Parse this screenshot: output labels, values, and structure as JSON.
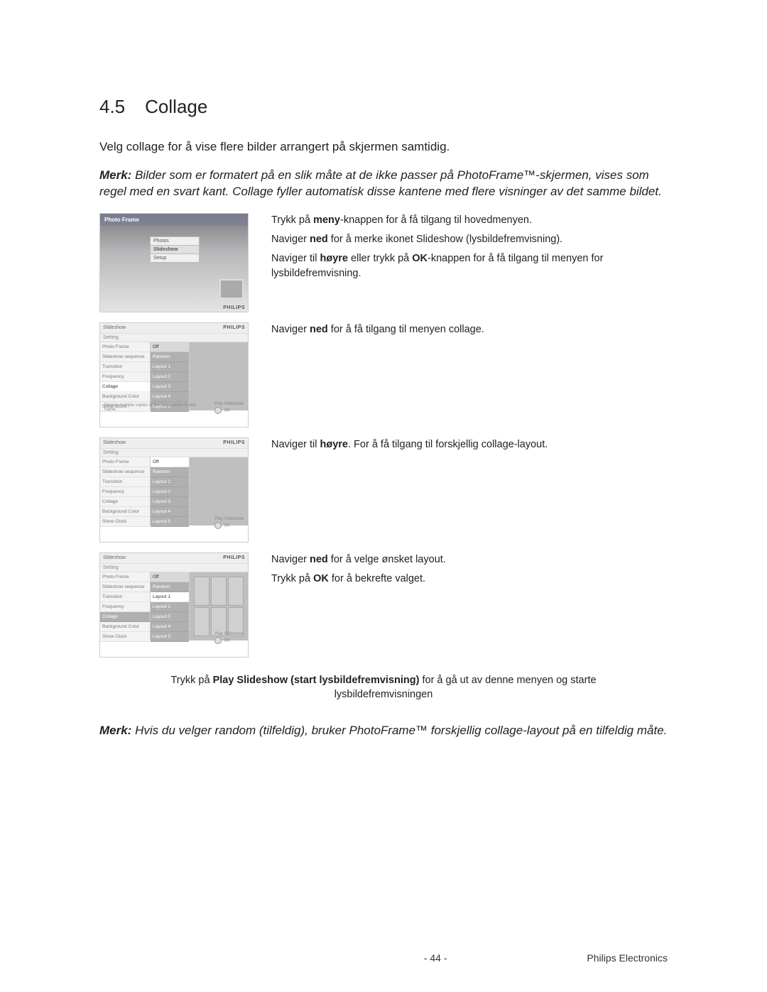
{
  "section": {
    "number": "4.5",
    "title": "Collage"
  },
  "intro": "Velg collage for å vise flere bilder arrangert på skjermen samtidig.",
  "note1": {
    "label": "Merk:",
    "text": "Bilder som er formatert på en slik måte at de ikke passer på PhotoFrame™-skjermen, vises som regel med en svart kant. Collage fyller automatisk disse kantene med flere visninger av det samme bildet."
  },
  "steps": [
    {
      "lines": [
        {
          "pre": "Trykk på ",
          "b": "meny",
          "post": "-knappen for å få tilgang til hovedmenyen."
        },
        {
          "pre": "Naviger ",
          "b": "ned",
          "post": " for å merke ikonet Slideshow (lysbildefremvisning)."
        },
        {
          "pre": "Naviger til ",
          "b": "høyre",
          "mid": " eller trykk på ",
          "b2": "OK",
          "post": "-knappen for å få tilgang til menyen for lysbildefremvisning."
        }
      ]
    },
    {
      "lines": [
        {
          "pre": "Naviger ",
          "b": "ned",
          "post": " for å få tilgang til menyen collage."
        }
      ]
    },
    {
      "lines": [
        {
          "pre": "Naviger til ",
          "b": "høyre",
          "post": ". For å få tilgang til forskjellig collage-layout."
        }
      ]
    },
    {
      "lines": [
        {
          "pre": "Naviger ",
          "b": "ned",
          "post": " for å velge ønsket layout."
        },
        {
          "pre": "Trykk på ",
          "b": "OK",
          "post": " for å bekrefte valget."
        }
      ]
    }
  ],
  "center_note": {
    "pre": "Trykk på ",
    "b": "Play Slideshow (start lysbildefremvisning)",
    "post": " for å gå ut av denne menyen og starte lysbildefremvisningen"
  },
  "note2": {
    "label": "Merk:",
    "text": "Hvis du velger random (tilfeldig), bruker PhotoFrame™ forskjellig collage-layout på en tilfeldig måte."
  },
  "ui": {
    "brand": "PHILIPS",
    "shot1": {
      "title": "Photo Frame",
      "items": [
        "Photos",
        "Slideshow",
        "Setup"
      ],
      "selected": 1
    },
    "grid_title": "Slideshow",
    "setting_label": "Setting",
    "left_items": [
      "Photo Frame",
      "Slideshow sequence",
      "Transition",
      "Frequency",
      "Collage",
      "Background Color",
      "Show Clock"
    ],
    "right_items": [
      "Off",
      "Random",
      "Layout 1",
      "Layout 2",
      "Layout 3",
      "Layout 4",
      "Layout 5"
    ],
    "hint_multi": "Display multiple copies of the same photo in one frame.",
    "play_label": "Play Slideshow",
    "ok_label": "OK"
  },
  "footer": {
    "page": "- 44 -",
    "company": "Philips Electronics"
  }
}
